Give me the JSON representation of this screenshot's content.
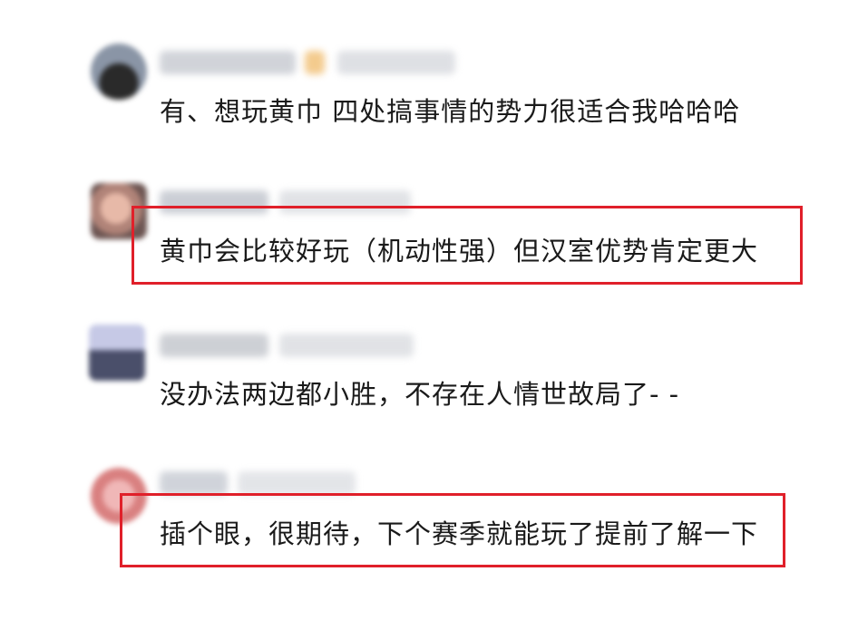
{
  "comments": [
    {
      "text": "有、想玩黄巾 四处搞事情的势力很适合我哈哈哈",
      "highlighted": false
    },
    {
      "text": "黄巾会比较好玩（机动性强）但汉室优势肯定更大",
      "highlighted": true
    },
    {
      "text": "没办法两边都小胜，不存在人情世故局了- -",
      "highlighted": false
    },
    {
      "text": "插个眼，很期待，下个赛季就能玩了提前了解一下",
      "highlighted": true
    }
  ],
  "colors": {
    "highlight_border": "#e0202a",
    "text": "#1a1a1a"
  }
}
